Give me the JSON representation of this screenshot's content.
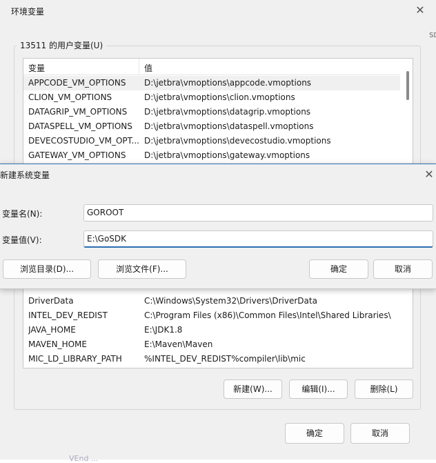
{
  "env_dialog": {
    "title": "环境变量",
    "close_glyph": "✕",
    "bg_strip_text": "SD",
    "user_group_label": "13511 的用户变量(U)",
    "columns": [
      "变量",
      "值"
    ],
    "rows_top": [
      {
        "name": "APPCODE_VM_OPTIONS",
        "value": "D:\\jetbra\\vmoptions\\appcode.vmoptions"
      },
      {
        "name": "CLION_VM_OPTIONS",
        "value": "D:\\jetbra\\vmoptions\\clion.vmoptions"
      },
      {
        "name": "DATAGRIP_VM_OPTIONS",
        "value": "D:\\jetbra\\vmoptions\\datagrip.vmoptions"
      },
      {
        "name": "DATASPELL_VM_OPTIONS",
        "value": "D:\\jetbra\\vmoptions\\dataspell.vmoptions"
      },
      {
        "name": "DEVECOSTUDIO_VM_OPT...",
        "value": "D:\\jetbra\\vmoptions\\devecostudio.vmoptions"
      },
      {
        "name": "GATEWAY_VM_OPTIONS",
        "value": "D:\\jetbra\\vmoptions\\gateway.vmoptions"
      }
    ],
    "rows_bottom": [
      {
        "name": "DriverData",
        "value": "C:\\Windows\\System32\\Drivers\\DriverData"
      },
      {
        "name": "INTEL_DEV_REDIST",
        "value": "C:\\Program Files (x86)\\Common Files\\Intel\\Shared Libraries\\"
      },
      {
        "name": "JAVA_HOME",
        "value": "E:\\JDK1.8"
      },
      {
        "name": "MAVEN_HOME",
        "value": "E:\\Maven\\Maven"
      },
      {
        "name": "MIC_LD_LIBRARY_PATH",
        "value": "%INTEL_DEV_REDIST%compiler\\lib\\mic"
      }
    ],
    "buttons": {
      "new": "新建(W)...",
      "edit": "编辑(I)...",
      "delete": "删除(L)",
      "ok": "确定",
      "cancel": "取消"
    },
    "bottom_peek": "VEnd ... "
  },
  "new_dialog": {
    "title": "新建系统变量",
    "close_glyph": "✕",
    "name_label": "变量名(N):",
    "value_label": "变量值(V):",
    "name_value": "GOROOT",
    "value_value": "E:\\GoSDK",
    "buttons": {
      "browse_dir": "浏览目录(D)...",
      "browse_file": "浏览文件(F)...",
      "ok": "确定",
      "cancel": "取消"
    }
  }
}
